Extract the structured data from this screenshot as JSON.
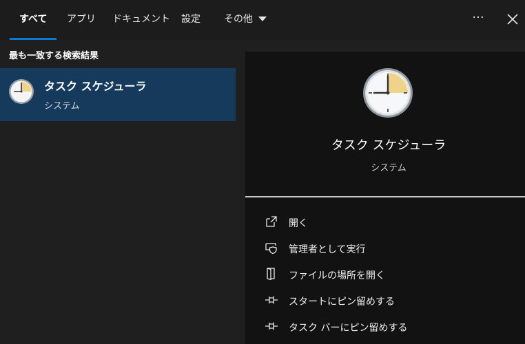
{
  "tabs": [
    {
      "label": "すべて",
      "active": true
    },
    {
      "label": "アプリ"
    },
    {
      "label": "ドキュメント"
    },
    {
      "label": "設定"
    },
    {
      "label": "その他"
    }
  ],
  "header": {
    "more_label": "···"
  },
  "best_match": {
    "section_title": "最も一致する検索結果",
    "item": {
      "title": "タスク スケジューラ",
      "subtitle": "システム",
      "icon": "clock-icon"
    }
  },
  "preview": {
    "title": "タスク スケジューラ",
    "subtitle": "システム",
    "actions": [
      {
        "label": "開く",
        "icon": "open-icon"
      },
      {
        "label": "管理者として実行",
        "icon": "admin-shield-icon"
      },
      {
        "label": "ファイルの場所を開く",
        "icon": "file-location-icon"
      },
      {
        "label": "スタートにピン留めする",
        "icon": "pin-icon"
      },
      {
        "label": "タスク バーにピン留めする",
        "icon": "pin-icon"
      }
    ]
  },
  "colors": {
    "accent": "#0a78d7",
    "selected_bg": "#163a5c"
  }
}
